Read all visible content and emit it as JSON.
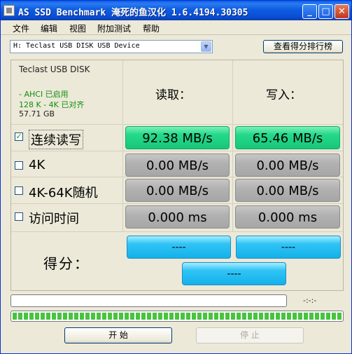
{
  "window": {
    "title": "AS SSD Benchmark 淹死的鱼汉化 1.6.4194.30305",
    "minimize": "_",
    "maximize": "□",
    "close": "✕"
  },
  "menu": [
    "文件",
    "编辑",
    "视图",
    "附加测试",
    "帮助"
  ],
  "drive_selector": {
    "value": "H: Teclast USB DISK USB Device",
    "arrow": "▼"
  },
  "rank_button": "查看得分排行榜",
  "drive_info": {
    "name": "Teclast USB DISK",
    "ahci": "- AHCI 已启用",
    "alignment": "128 K - 4K 已对齐",
    "size": "57.71 GB"
  },
  "columns": {
    "read": "读取：",
    "write": "写入："
  },
  "tests": [
    {
      "label": "连续读写",
      "checked": true,
      "check_mark": "✓",
      "read": "92.38 MB/s",
      "write": "65.46 MB/s"
    },
    {
      "label": "4K",
      "checked": false,
      "check_mark": "",
      "read": "0.00 MB/s",
      "write": "0.00 MB/s"
    },
    {
      "label": "4K-64K随机",
      "checked": false,
      "check_mark": "",
      "read": "0.00 MB/s",
      "write": "0.00 MB/s"
    },
    {
      "label": "访问时间",
      "checked": false,
      "check_mark": "",
      "read": "0.000 ms",
      "write": "0.000 ms"
    }
  ],
  "score": {
    "label": "得分：",
    "read": "----",
    "write": "----",
    "total": "----"
  },
  "progress": {
    "fraction": 0,
    "time": "-:-:-"
  },
  "buttons": {
    "start": "开  始",
    "stop": "停  止"
  },
  "colors": {
    "result_active": "#25d98a",
    "result_idle": "#b2b2b2",
    "score": "#30c4f5",
    "info_text": "#109010"
  }
}
